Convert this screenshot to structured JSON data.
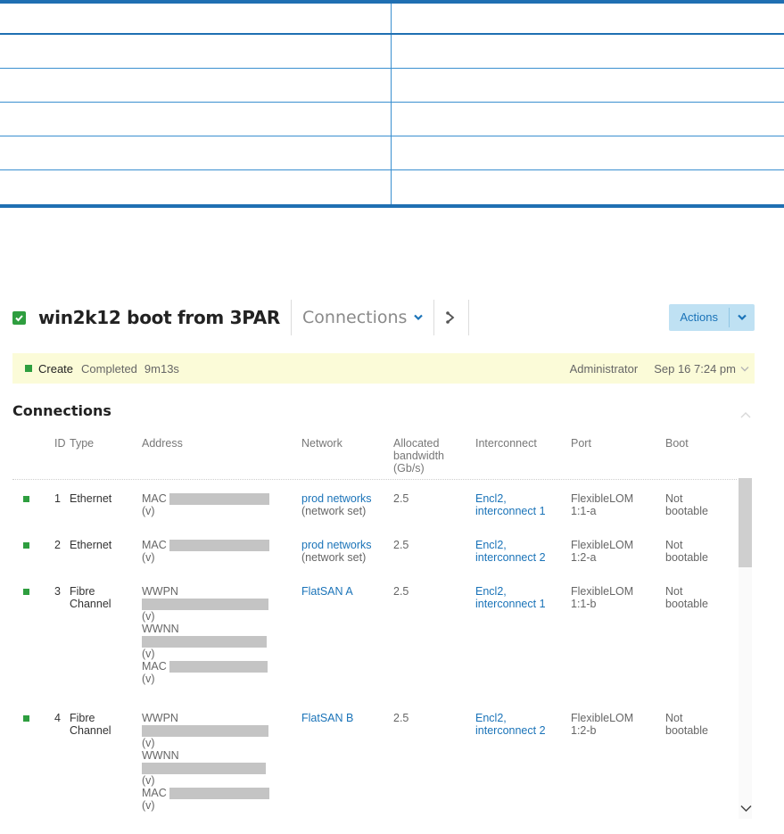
{
  "header": {
    "title": "win2k12 boot from 3PAR",
    "view": "Connections",
    "actions_label": "Actions",
    "status_icon": "check-icon",
    "related_icon": "related-resources-icon"
  },
  "activity": {
    "name": "Create",
    "state": "Completed",
    "duration": "9m13s",
    "user": "Administrator",
    "time": "Sep 16 7:24 pm"
  },
  "section": {
    "title": "Connections"
  },
  "table": {
    "columns": {
      "id": "ID",
      "type": "Type",
      "address": "Address",
      "network": "Network",
      "bandwidth_1": "Allocated",
      "bandwidth_2": "bandwidth",
      "bandwidth_3": "(Gb/s)",
      "interconnect": "Interconnect",
      "port": "Port",
      "boot": "Boot"
    },
    "rows": [
      {
        "id": "1",
        "type_1": "Ethernet",
        "type_2": "",
        "mac_label": "MAC",
        "mac_v": "(v)",
        "network": "prod networks",
        "network_sub": "(network set)",
        "bandwidth": "2.5",
        "ic_1": "Encl2,",
        "ic_2": "interconnect 1",
        "port_1": "FlexibleLOM",
        "port_2": "1:1-a",
        "boot_1": "Not",
        "boot_2": "bootable"
      },
      {
        "id": "2",
        "type_1": "Ethernet",
        "type_2": "",
        "mac_label": "MAC",
        "mac_v": "(v)",
        "network": "prod networks",
        "network_sub": "(network set)",
        "bandwidth": "2.5",
        "ic_1": "Encl2,",
        "ic_2": "interconnect 2",
        "port_1": "FlexibleLOM",
        "port_2": "1:2-a",
        "boot_1": "Not",
        "boot_2": "bootable"
      },
      {
        "id": "3",
        "type_1": "Fibre",
        "type_2": "Channel",
        "wwpn_label": "WWPN",
        "wwpn_v": "(v)",
        "wwnn_label": "WWNN",
        "wwnn_v": "(v)",
        "mac_label": "MAC",
        "mac_v": "(v)",
        "network": "FlatSAN A",
        "bandwidth": "2.5",
        "ic_1": "Encl2,",
        "ic_2": "interconnect 1",
        "port_1": "FlexibleLOM",
        "port_2": "1:1-b",
        "boot_1": "Not",
        "boot_2": "bootable"
      },
      {
        "id": "4",
        "type_1": "Fibre",
        "type_2": "Channel",
        "wwpn_label": "WWPN",
        "wwpn_v": "(v)",
        "wwnn_label": "WWNN",
        "wwnn_v": "(v)",
        "mac_label": "MAC",
        "mac_v": "(v)",
        "network": "FlatSAN B",
        "bandwidth": "2.5",
        "ic_1": "Encl2,",
        "ic_2": "interconnect 2",
        "port_1": "FlexibleLOM",
        "port_2": "1:2-b",
        "boot_1": "Not",
        "boot_2": "bootable"
      }
    ]
  },
  "colors": {
    "accent_blue": "#1a73b8",
    "status_green": "#2e9e3f",
    "activity_bg": "#fbfbd8",
    "actions_bg": "#bfe1f3",
    "table_rule": "#1f6fb2"
  }
}
